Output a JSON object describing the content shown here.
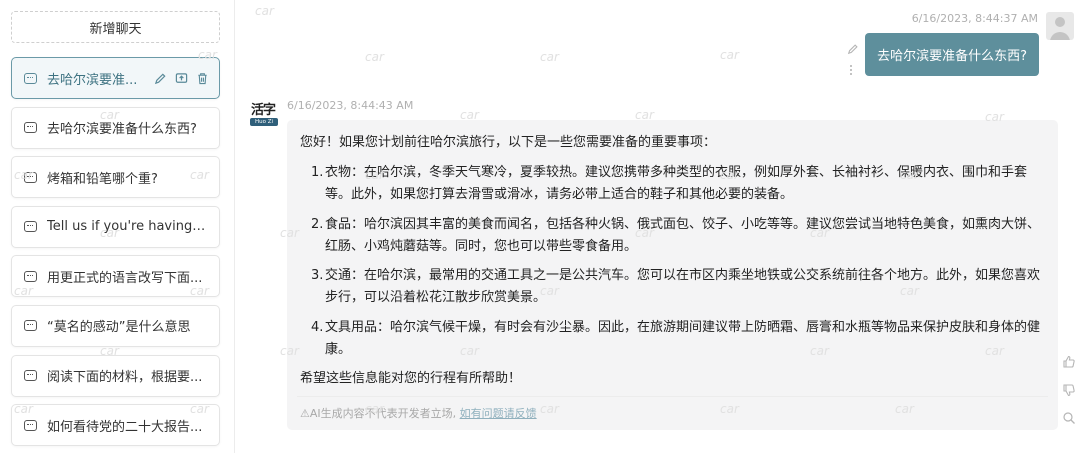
{
  "sidebar": {
    "new_chat_label": "新增聊天",
    "conversations": [
      {
        "title": "去哈尔滨要准...",
        "active": true
      },
      {
        "title": "去哈尔滨要准备什么东西?",
        "active": false
      },
      {
        "title": "烤箱和铅笔哪个重?",
        "active": false
      },
      {
        "title": "Tell us if you're having a ...",
        "active": false
      },
      {
        "title": "用更正式的语言改写下面...",
        "active": false
      },
      {
        "title": "“莫名的感动”是什么意思",
        "active": false
      },
      {
        "title": "阅读下面的材料，根据要...",
        "active": false
      },
      {
        "title": "如何看待党的二十大报告...",
        "active": false
      }
    ]
  },
  "chat": {
    "user_message": {
      "timestamp": "6/16/2023, 8:44:37 AM",
      "text": "去哈尔滨要准备什么东西?"
    },
    "bot_message": {
      "logo_text": "活字",
      "logo_tag": "Huo Zi",
      "timestamp": "6/16/2023, 8:44:43 AM",
      "intro": "您好！如果您计划前往哈尔滨旅行，以下是一些您需要准备的重要事项：",
      "items": [
        {
          "num": "1.",
          "text": "衣物：在哈尔滨，冬季天气寒冷，夏季较热。建议您携带多种类型的衣服，例如厚外套、长袖衬衫、保暖内衣、围巾和手套等。此外，如果您打算去滑雪或滑冰，请务必带上适合的鞋子和其他必要的装备。"
        },
        {
          "num": "2.",
          "text": "食品：哈尔滨因其丰富的美食而闻名，包括各种火锅、俄式面包、饺子、小吃等等。建议您尝试当地特色美食，如熏肉大饼、红肠、小鸡炖蘑菇等。同时，您也可以带些零食备用。"
        },
        {
          "num": "3.",
          "text": "交通：在哈尔滨，最常用的交通工具之一是公共汽车。您可以在市区内乘坐地铁或公交系统前往各个地方。此外，如果您喜欢步行，可以沿着松花江散步欣赏美景。"
        },
        {
          "num": "4.",
          "text": "文具用品：哈尔滨气候干燥，有时会有沙尘暴。因此，在旅游期间建议带上防晒霜、唇膏和水瓶等物品来保护皮肤和身体的健康。"
        }
      ],
      "closing": "希望这些信息能对您的行程有所帮助！",
      "disclaimer": "⚠AI生成内容不代表开发者立场,",
      "feedback_link": "如有问题请反馈"
    }
  },
  "watermark_text": "car",
  "colors": {
    "accent": "#5e8f9c",
    "active_item_bg": "#f2f7f9",
    "bot_bubble_bg": "#f4f4f5"
  }
}
